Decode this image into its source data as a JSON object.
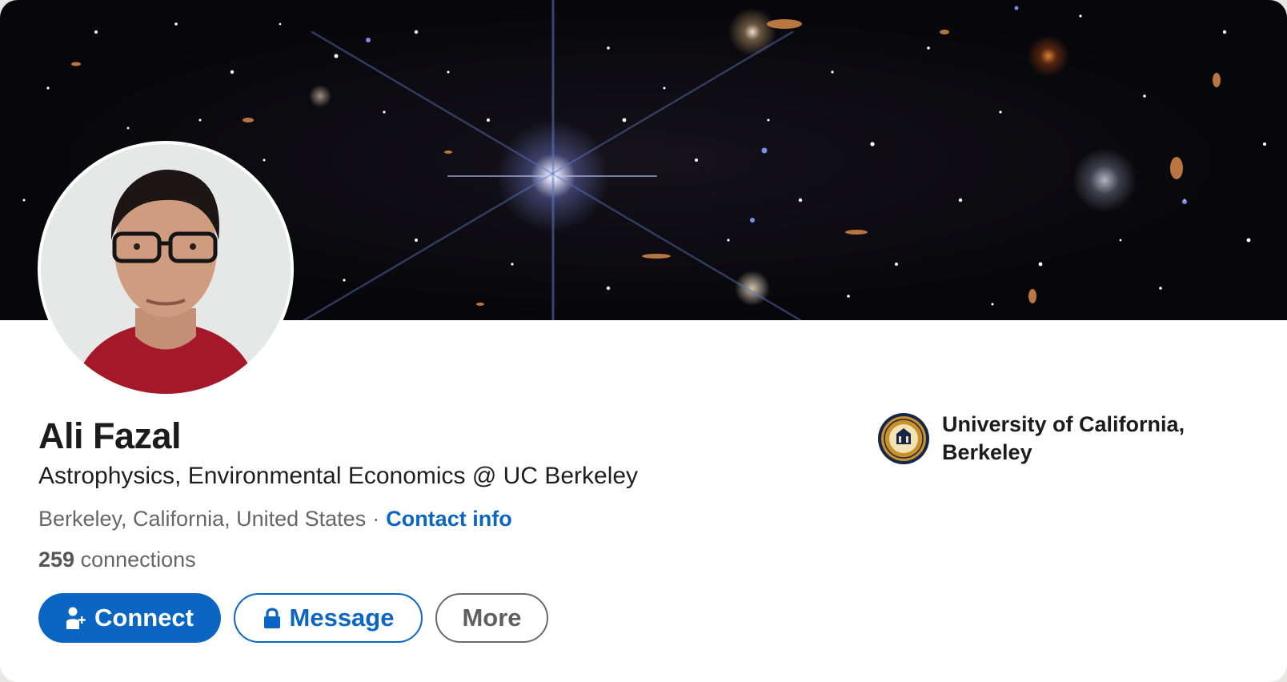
{
  "profile": {
    "name": "Ali Fazal",
    "headline": "Astrophysics, Environmental Economics @ UC Berkeley",
    "location": "Berkeley, California, United States",
    "separator": "·",
    "contact_info_label": "Contact info",
    "connections_count": "259",
    "connections_label": "connections"
  },
  "actions": {
    "connect_label": "Connect",
    "message_label": "Message",
    "more_label": "More"
  },
  "education": {
    "school_name": "University of California, Berkeley"
  },
  "icons": {
    "connect": "add-person-icon",
    "message": "lock-icon",
    "school": "uc-berkeley-seal"
  },
  "colors": {
    "accent": "#0a66c2",
    "text_primary": "#1c1c1c",
    "text_secondary": "#666666",
    "more_border": "#6a6a6a"
  }
}
